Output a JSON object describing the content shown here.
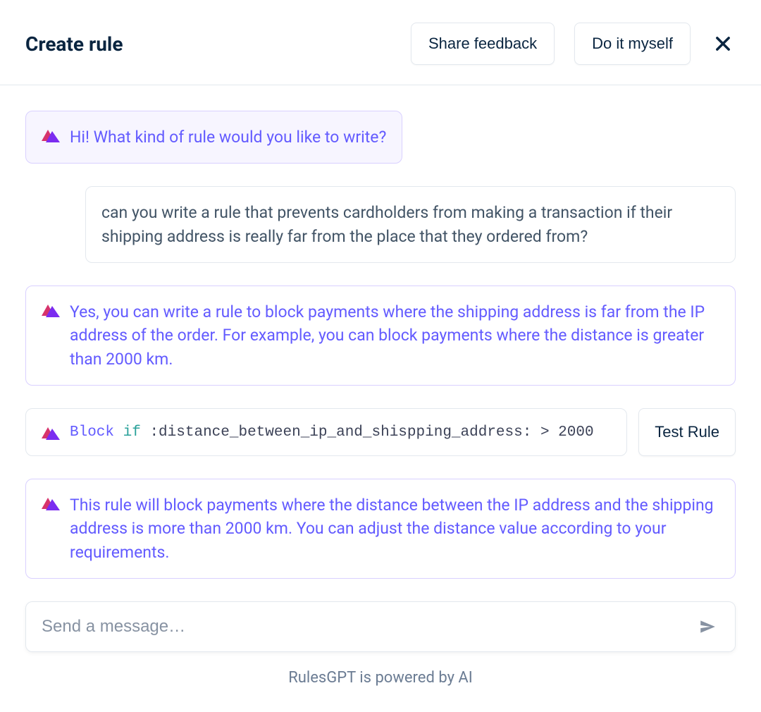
{
  "header": {
    "title": "Create rule",
    "share_label": "Share feedback",
    "diy_label": "Do it myself"
  },
  "messages": {
    "intro": "Hi! What kind of rule would you like to write?",
    "user1": "can you write a rule that prevents cardholders from making a transaction if their shipping address is really far from the place that they ordered from?",
    "assistant1": "Yes, you can write a rule to block payments where the shipping address is far from the IP address of the order. For example, you can block payments where the distance is greater than 2000 km.",
    "assistant2": "This rule will block payments where the distance between the IP address and the shipping address is more than 2000 km. You can adjust the distance value according to your requirements."
  },
  "code": {
    "kw_block": "Block",
    "kw_if": "if",
    "rest": ":distance_between_ip_and_shispping_address: > 2000",
    "test_label": "Test Rule"
  },
  "input": {
    "placeholder": "Send a message…"
  },
  "footer": "RulesGPT is powered by AI"
}
